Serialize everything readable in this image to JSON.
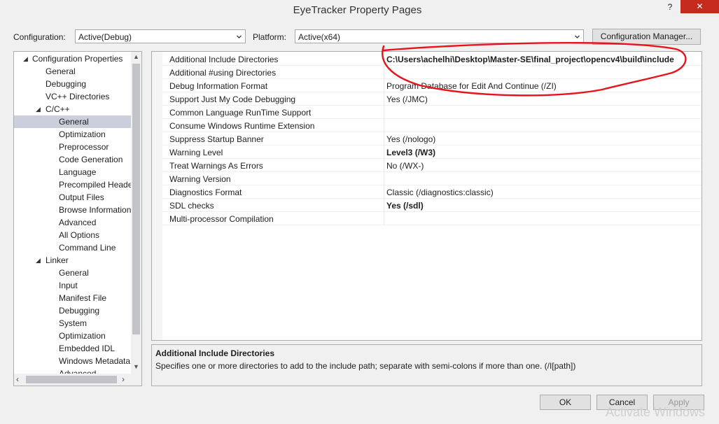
{
  "window": {
    "title": "EyeTracker Property Pages",
    "help": "?",
    "close": "✕"
  },
  "toolbar": {
    "configuration_label": "Configuration:",
    "configuration_value": "Active(Debug)",
    "platform_label": "Platform:",
    "platform_value": "Active(x64)",
    "config_manager": "Configuration Manager..."
  },
  "tree": [
    {
      "label": "Configuration Properties",
      "level": 0,
      "expander": "◢"
    },
    {
      "label": "General",
      "level": 1
    },
    {
      "label": "Debugging",
      "level": 1
    },
    {
      "label": "VC++ Directories",
      "level": 1
    },
    {
      "label": "C/C++",
      "level": 1,
      "expander": "◢"
    },
    {
      "label": "General",
      "level": 2,
      "selected": true
    },
    {
      "label": "Optimization",
      "level": 2
    },
    {
      "label": "Preprocessor",
      "level": 2
    },
    {
      "label": "Code Generation",
      "level": 2
    },
    {
      "label": "Language",
      "level": 2
    },
    {
      "label": "Precompiled Heade",
      "level": 2
    },
    {
      "label": "Output Files",
      "level": 2
    },
    {
      "label": "Browse Information",
      "level": 2
    },
    {
      "label": "Advanced",
      "level": 2
    },
    {
      "label": "All Options",
      "level": 2
    },
    {
      "label": "Command Line",
      "level": 2
    },
    {
      "label": "Linker",
      "level": 1,
      "expander": "◢"
    },
    {
      "label": "General",
      "level": 2
    },
    {
      "label": "Input",
      "level": 2
    },
    {
      "label": "Manifest File",
      "level": 2
    },
    {
      "label": "Debugging",
      "level": 2
    },
    {
      "label": "System",
      "level": 2
    },
    {
      "label": "Optimization",
      "level": 2
    },
    {
      "label": "Embedded IDL",
      "level": 2
    },
    {
      "label": "Windows Metadata",
      "level": 2
    },
    {
      "label": "Advanced",
      "level": 2
    }
  ],
  "properties": [
    {
      "name": "Additional Include Directories",
      "value": "C:\\Users\\achelhi\\Desktop\\Master-SE\\final_project\\opencv4\\build\\include",
      "bold": true
    },
    {
      "name": "Additional #using Directories",
      "value": ""
    },
    {
      "name": "Debug Information Format",
      "value": "Program Database for Edit And Continue (/ZI)"
    },
    {
      "name": "Support Just My Code Debugging",
      "value": "Yes (/JMC)"
    },
    {
      "name": "Common Language RunTime Support",
      "value": ""
    },
    {
      "name": "Consume Windows Runtime Extension",
      "value": ""
    },
    {
      "name": "Suppress Startup Banner",
      "value": "Yes (/nologo)"
    },
    {
      "name": "Warning Level",
      "value": "Level3 (/W3)",
      "bold": true
    },
    {
      "name": "Treat Warnings As Errors",
      "value": "No (/WX-)"
    },
    {
      "name": "Warning Version",
      "value": ""
    },
    {
      "name": "Diagnostics Format",
      "value": "Classic (/diagnostics:classic)"
    },
    {
      "name": "SDL checks",
      "value": "Yes (/sdl)",
      "bold": true
    },
    {
      "name": "Multi-processor Compilation",
      "value": ""
    }
  ],
  "description": {
    "title": "Additional Include Directories",
    "text": "Specifies one or more directories to add to the include path; separate with semi-colons if more than one.     (/I[path])"
  },
  "buttons": {
    "ok": "OK",
    "cancel": "Cancel",
    "apply": "Apply"
  },
  "watermark": "Activate Windows",
  "colors": {
    "selection": "#cccedb",
    "annotation": "#e8141b",
    "close": "#c42b1c"
  }
}
